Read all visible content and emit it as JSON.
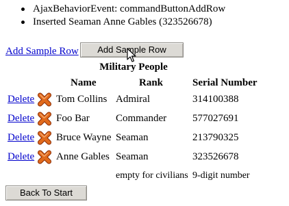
{
  "messages": [
    "AjaxBehaviorEvent: commandButtonAddRow",
    "Inserted Seaman Anne Gables (323526678)"
  ],
  "add_sample_link": "Add Sample Row",
  "add_sample_button": "Add Sample Row",
  "table": {
    "caption": "Military People",
    "headers": {
      "name": "Name",
      "rank": "Rank",
      "serial": "Serial Number"
    },
    "delete_label": "Delete",
    "rows": [
      {
        "name": "Tom Collins",
        "rank": "Admiral",
        "serial": "314100388"
      },
      {
        "name": "Foo Bar",
        "rank": "Commander",
        "serial": "577027691"
      },
      {
        "name": "Bruce Wayne",
        "rank": "Seaman",
        "serial": "213790325"
      },
      {
        "name": "Anne Gables",
        "rank": "Seaman",
        "serial": "323526678"
      }
    ],
    "footer": {
      "rank": "empty for civilians",
      "serial": "9-digit number"
    }
  },
  "back_button": "Back To Start",
  "colors": {
    "link": "#0000cc",
    "delete_icon": "#e06a1c",
    "button_bg": "#dcdad5"
  },
  "icons": {
    "delete": "x-icon",
    "pointer": "mouse-cursor-icon"
  }
}
